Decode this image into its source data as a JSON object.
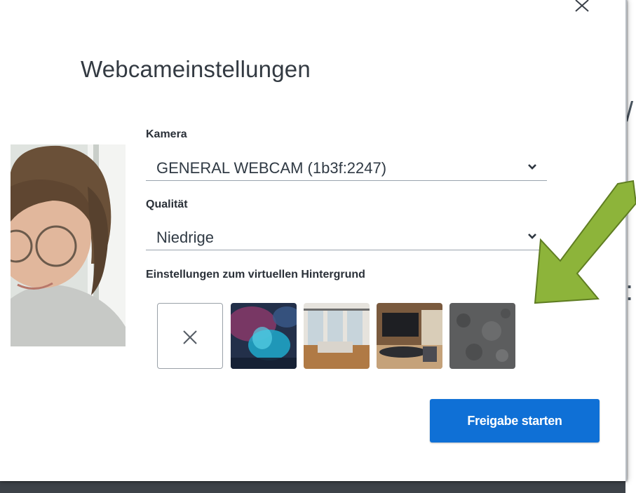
{
  "dialog": {
    "title": "Webcameinstellungen",
    "close_icon": "close-icon"
  },
  "camera": {
    "label": "Kamera",
    "value": "GENERAL WEBCAM (1b3f:2247)"
  },
  "quality": {
    "label": "Qualität",
    "value": "Niedrige"
  },
  "virtual_background": {
    "label": "Einstellungen zum virtuellen Hintergrund",
    "options": [
      "none",
      "aurora-blur",
      "office-windows",
      "conference-room",
      "dark-texture"
    ]
  },
  "actions": {
    "start_label": "Freigabe starten"
  },
  "colors": {
    "primary": "#0f70d6",
    "annotation_arrow": "#8db43a"
  }
}
